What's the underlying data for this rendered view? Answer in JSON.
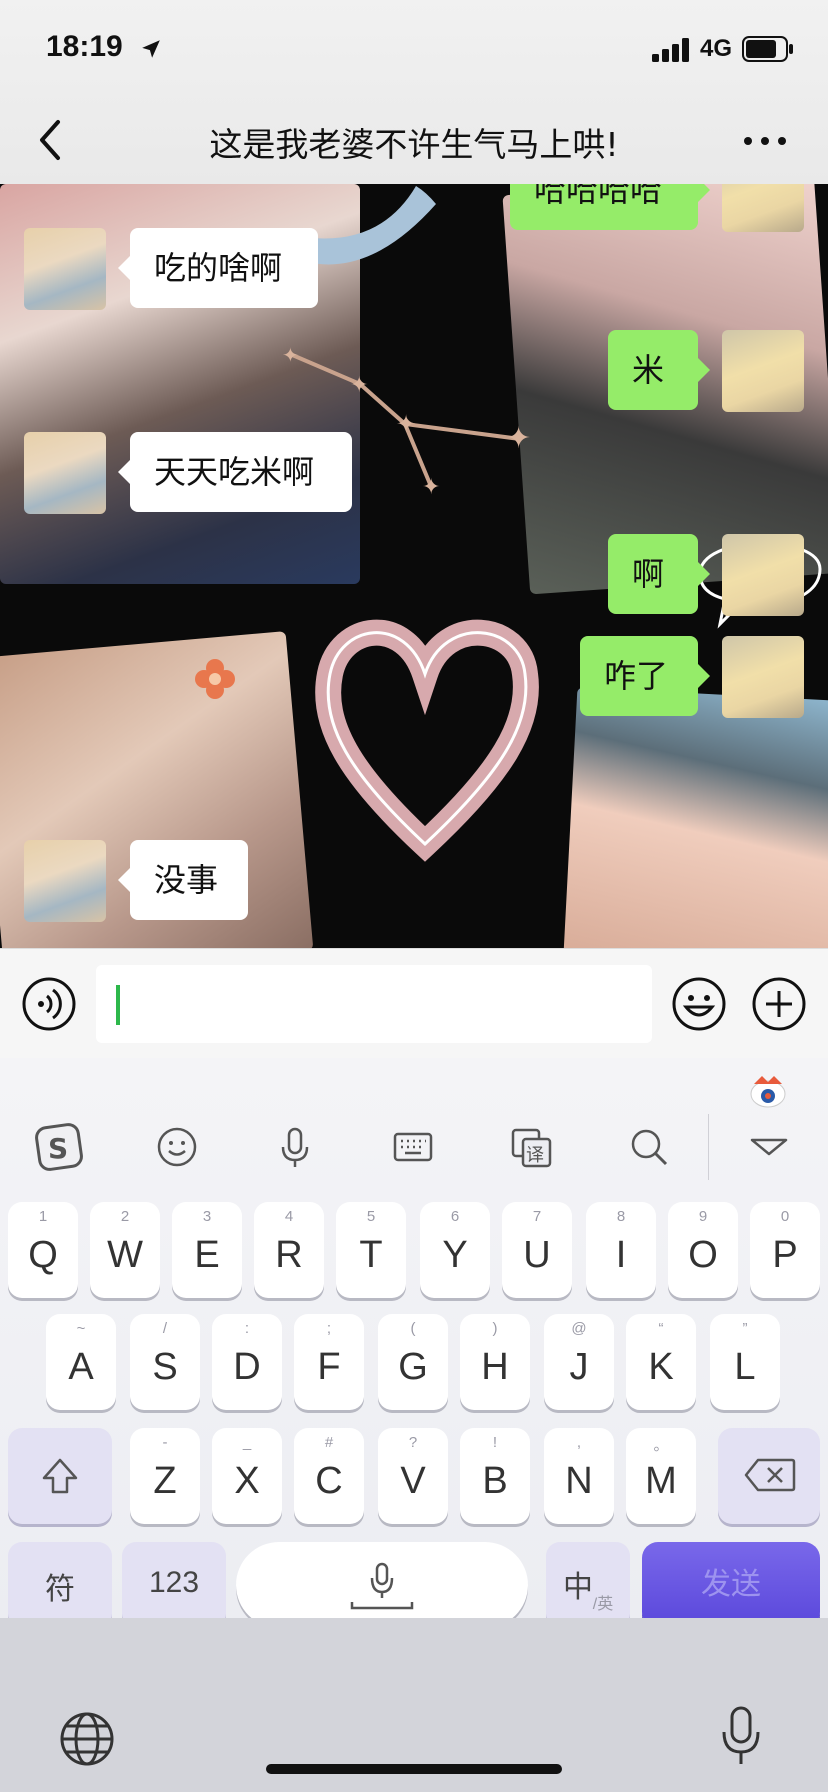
{
  "status": {
    "time": "18:19",
    "network": "4G"
  },
  "nav": {
    "title": "这是我老婆不许生气马上哄!"
  },
  "messages": [
    {
      "side": "right",
      "text": "哈哈哈哈"
    },
    {
      "side": "left",
      "text": "吃的啥啊"
    },
    {
      "side": "right",
      "text": "米"
    },
    {
      "side": "left",
      "text": "天天吃米啊"
    },
    {
      "side": "right",
      "text": "啊"
    },
    {
      "side": "right",
      "text": "咋了"
    },
    {
      "side": "left",
      "text": "没事"
    }
  ],
  "input": {
    "value": ""
  },
  "keyboard": {
    "row1": [
      {
        "sub": "1",
        "main": "Q"
      },
      {
        "sub": "2",
        "main": "W"
      },
      {
        "sub": "3",
        "main": "E"
      },
      {
        "sub": "4",
        "main": "R"
      },
      {
        "sub": "5",
        "main": "T"
      },
      {
        "sub": "6",
        "main": "Y"
      },
      {
        "sub": "7",
        "main": "U"
      },
      {
        "sub": "8",
        "main": "I"
      },
      {
        "sub": "9",
        "main": "O"
      },
      {
        "sub": "0",
        "main": "P"
      }
    ],
    "row2": [
      {
        "sub": "~",
        "main": "A"
      },
      {
        "sub": "/",
        "main": "S"
      },
      {
        "sub": ":",
        "main": "D"
      },
      {
        "sub": ";",
        "main": "F"
      },
      {
        "sub": "(",
        "main": "G"
      },
      {
        "sub": ")",
        "main": "H"
      },
      {
        "sub": "@",
        "main": "J"
      },
      {
        "sub": "“",
        "main": "K"
      },
      {
        "sub": "”",
        "main": "L"
      }
    ],
    "row3": [
      {
        "sub": "-",
        "main": "Z"
      },
      {
        "sub": "_",
        "main": "X"
      },
      {
        "sub": "#",
        "main": "C"
      },
      {
        "sub": "?",
        "main": "V"
      },
      {
        "sub": "!",
        "main": "B"
      },
      {
        "sub": ",",
        "main": "N"
      },
      {
        "sub": "。",
        "main": "M"
      }
    ],
    "symbols_label": "符",
    "numbers_label": "123",
    "lang_label": "中",
    "lang_sub": "/英",
    "send_label": "发送"
  }
}
